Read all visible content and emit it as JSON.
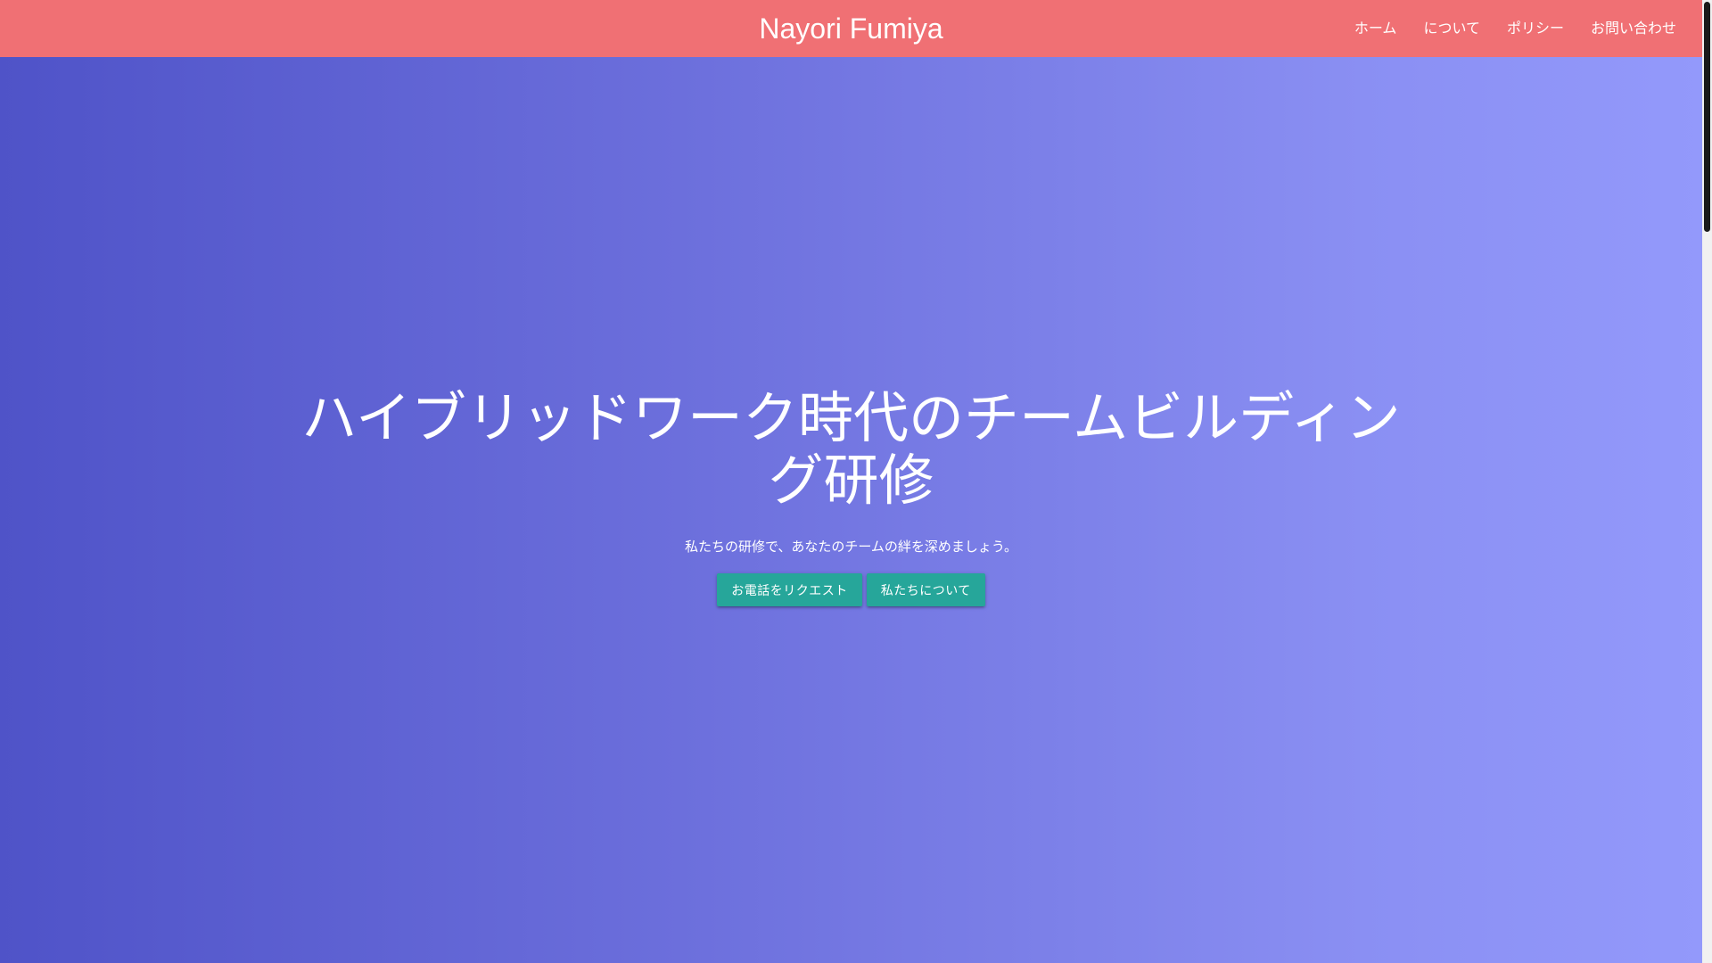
{
  "header": {
    "brand": "Nayori Fumiya",
    "nav": [
      {
        "label": "ホーム"
      },
      {
        "label": "について"
      },
      {
        "label": "ポリシー"
      },
      {
        "label": "お問い合わせ"
      }
    ]
  },
  "hero": {
    "title": "ハイブリッドワーク時代のチームビルディング研修",
    "subtitle": "私たちの研修で、あなたのチームの絆を深めましょう。",
    "buttons": [
      {
        "label": "お電話をリクエスト"
      },
      {
        "label": "私たちについて"
      }
    ]
  },
  "colors": {
    "header": "#f07074",
    "gradient_start": "#4f53c8",
    "gradient_end": "#9399fb",
    "button": "#26a69a"
  }
}
